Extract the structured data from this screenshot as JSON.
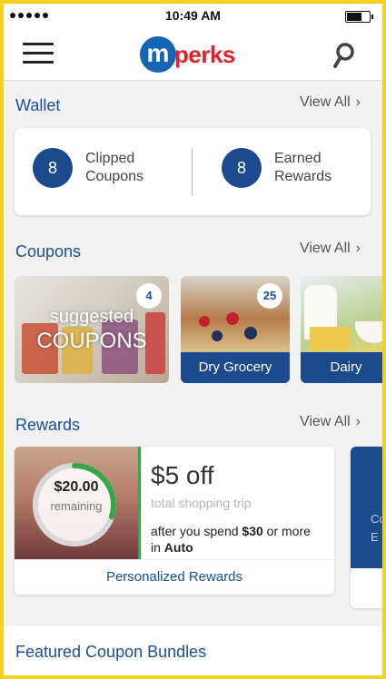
{
  "status_bar": {
    "time": "10:49 AM"
  },
  "header": {
    "logo_m": "m",
    "logo_text": "perks"
  },
  "wallet": {
    "title": "Wallet",
    "view_all": "View All",
    "items": [
      {
        "count": "8",
        "label_line1": "Clipped",
        "label_line2": "Coupons"
      },
      {
        "count": "8",
        "label_line1": "Earned",
        "label_line2": "Rewards"
      }
    ]
  },
  "coupons": {
    "title": "Coupons",
    "view_all": "View All",
    "tiles": [
      {
        "badge": "4",
        "overlay_line1": "suggested",
        "overlay_line2": "COUPONS",
        "label": ""
      },
      {
        "badge": "25",
        "label": "Dry Grocery"
      },
      {
        "badge": "",
        "label": "Dairy"
      }
    ]
  },
  "rewards": {
    "title": "Rewards",
    "view_all": "View All",
    "card": {
      "amount": "$20.00",
      "remaining_label": "remaining",
      "progress_fraction": 0.3,
      "offer": "$5 off",
      "subtitle": "total shopping trip",
      "condition_prefix": "after you spend ",
      "condition_amount": "$30",
      "condition_mid": " or more",
      "condition_in": "in ",
      "condition_store": "Auto",
      "footer": "Personalized Rewards"
    },
    "card2_partial": {
      "line1": "Co",
      "line2": "E"
    }
  },
  "featured": {
    "title": "Featured Coupon Bundles"
  },
  "colors": {
    "brand_blue": "#1c4a8f",
    "brand_red": "#e0202a",
    "progress_green": "#3aa64a",
    "frame_yellow": "#f3d11e"
  },
  "icons": {
    "menu": "hamburger-icon",
    "search": "search-icon",
    "chevron": "chevron-right-icon"
  }
}
